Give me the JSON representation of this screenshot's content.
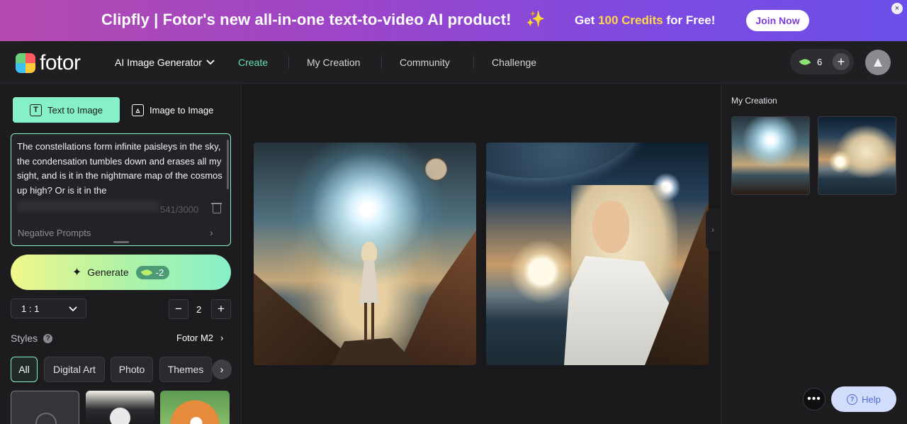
{
  "banner": {
    "headline": "Clipfly | Fotor's new all-in-one text-to-video AI product!",
    "sparkle_icon": "✨",
    "credits_prefix": "Get ",
    "credits_highlight": "100 Credits",
    "credits_suffix": " for Free!",
    "join_label": "Join Now",
    "close_glyph": "×"
  },
  "nav": {
    "logo_text": "fotor",
    "ai_generator_label": "AI Image Generator",
    "items": [
      "Create",
      "My Creation",
      "Community",
      "Challenge"
    ],
    "credit_count": "6",
    "accent_color": "#66e0ac"
  },
  "left_panel": {
    "tabs": [
      "Text to Image",
      "Image to Image"
    ],
    "prompt_text": "The constellations form infinite paisleys in the sky, the condensation tumbles down and erases all my sight, and is it in the nightmare map of the cosmos up high? Or is it in the",
    "char_count": "541/3000",
    "negative_prompts_label": "Negative Prompts",
    "generate_label": "Generate",
    "generate_cost": "-2",
    "ratio_value": "1 : 1",
    "image_count": "2",
    "minus_glyph": "−",
    "plus_glyph": "+",
    "styles_label": "Styles",
    "help_glyph": "?",
    "model_label": "Fotor M2",
    "style_chips": [
      "All",
      "Digital Art",
      "Photo",
      "Themes"
    ],
    "chevron_glyph": "›"
  },
  "right_panel": {
    "title": "My Creation"
  },
  "floating": {
    "more_glyph": "•••",
    "help_label": "Help",
    "help_glyph": "?"
  }
}
